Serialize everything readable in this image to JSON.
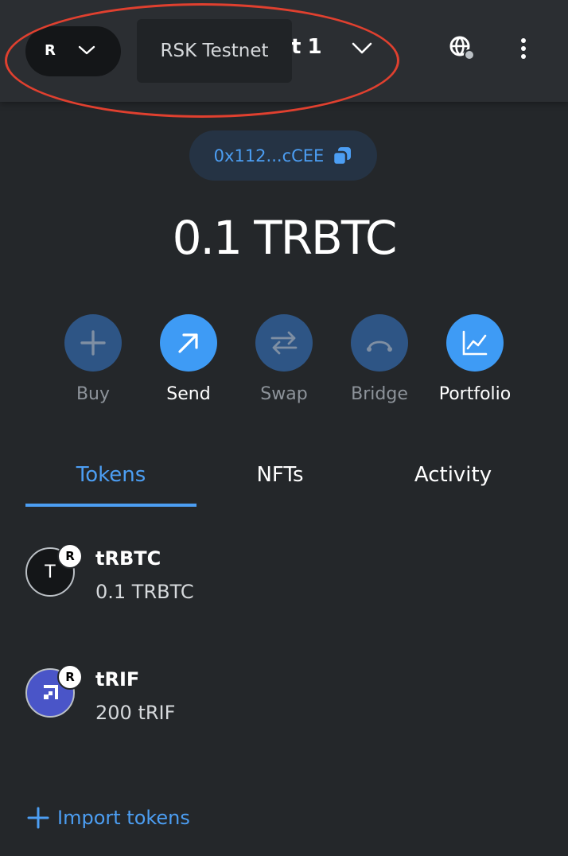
{
  "header": {
    "network_letter": "R",
    "network_tooltip": "RSK Testnet",
    "account_name": "unt 1",
    "icons": [
      "chevron-down-icon",
      "globe-icon",
      "kebab-menu-icon"
    ]
  },
  "address": {
    "short": "0x112...cCEE",
    "icon": "copy-icon"
  },
  "balance": "0.1 TRBTC",
  "actions": [
    {
      "label": "Buy",
      "icon": "plus-icon",
      "enabled": false
    },
    {
      "label": "Send",
      "icon": "arrow-up-right-icon",
      "enabled": true
    },
    {
      "label": "Swap",
      "icon": "swap-arrows-icon",
      "enabled": false
    },
    {
      "label": "Bridge",
      "icon": "bridge-icon",
      "enabled": false
    },
    {
      "label": "Portfolio",
      "icon": "chart-icon",
      "enabled": true
    }
  ],
  "tabs": [
    {
      "label": "Tokens",
      "active": true
    },
    {
      "label": "NFTs",
      "active": false
    },
    {
      "label": "Activity",
      "active": false
    }
  ],
  "tokens": [
    {
      "icon_letter": "T",
      "badge": "R",
      "name": "tRBTC",
      "balance": "0.1 TRBTC"
    },
    {
      "icon_letter": "",
      "badge": "R",
      "name": "tRIF",
      "balance": "200 tRIF"
    }
  ],
  "import_label": "Import tokens",
  "colors": {
    "accent": "#4c9ef3",
    "background": "#24272a",
    "annotation": "#e0402f"
  }
}
